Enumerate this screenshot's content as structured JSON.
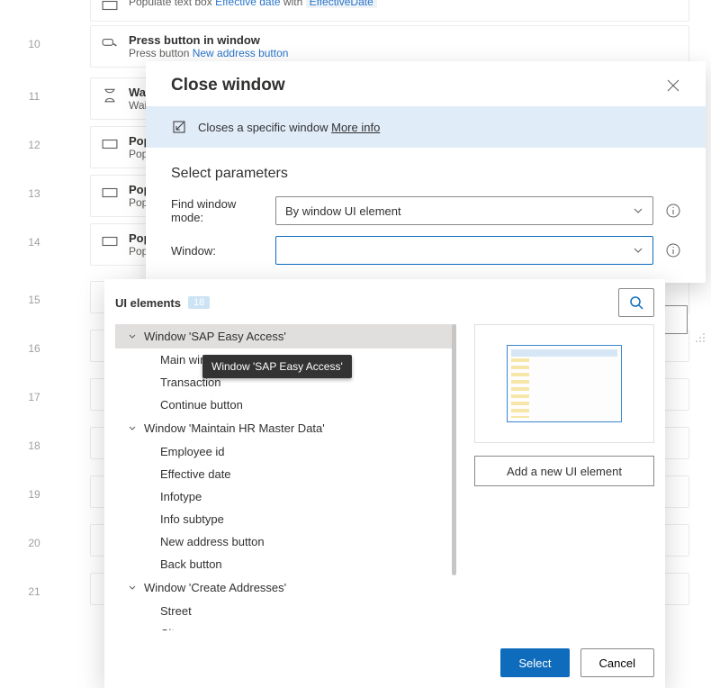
{
  "bg": {
    "lines": [
      "10",
      "11",
      "12",
      "13",
      "14",
      "15",
      "16",
      "17",
      "18",
      "19",
      "20",
      "21"
    ],
    "step0": {
      "sub_prefix": "Populate text box ",
      "sub_link": "Effective date",
      "sub_mid": " with ",
      "sub_tag": "EffectiveDate"
    },
    "step1": {
      "title": "Press button in window",
      "sub_prefix": "Press button ",
      "sub_link": "New address button"
    },
    "step2": {
      "title": "Wai",
      "sub": "Wait"
    },
    "step3": {
      "title": "Pop",
      "sub": "Popu"
    },
    "step4": {
      "title": "Pop",
      "sub": "Popu"
    },
    "step5": {
      "title": "Pop",
      "sub": "Popu"
    },
    "close_step": "Close window"
  },
  "dialog": {
    "title": "Close window",
    "banner_text": "Closes a specific window ",
    "banner_more": "More info",
    "section": "Select parameters",
    "find_mode_label": "Find window mode:",
    "find_mode_value": "By window UI element",
    "window_label": "Window:",
    "window_value": ""
  },
  "panel": {
    "heading": "UI elements",
    "count": "18",
    "groups": [
      {
        "name": "Window 'SAP Easy Access'",
        "selected": true,
        "items": [
          "Main win",
          "Transaction",
          "Continue button"
        ]
      },
      {
        "name": "Window 'Maintain HR Master Data'",
        "selected": false,
        "items": [
          "Employee id",
          "Effective date",
          "Infotype",
          "Info subtype",
          "New address button",
          "Back button"
        ]
      },
      {
        "name": "Window 'Create Addresses'",
        "selected": false,
        "items": [
          "Street",
          "City"
        ]
      }
    ],
    "tooltip": "Window 'SAP Easy Access'",
    "add_btn": "Add a new UI element",
    "select": "Select",
    "cancel": "Cancel"
  }
}
